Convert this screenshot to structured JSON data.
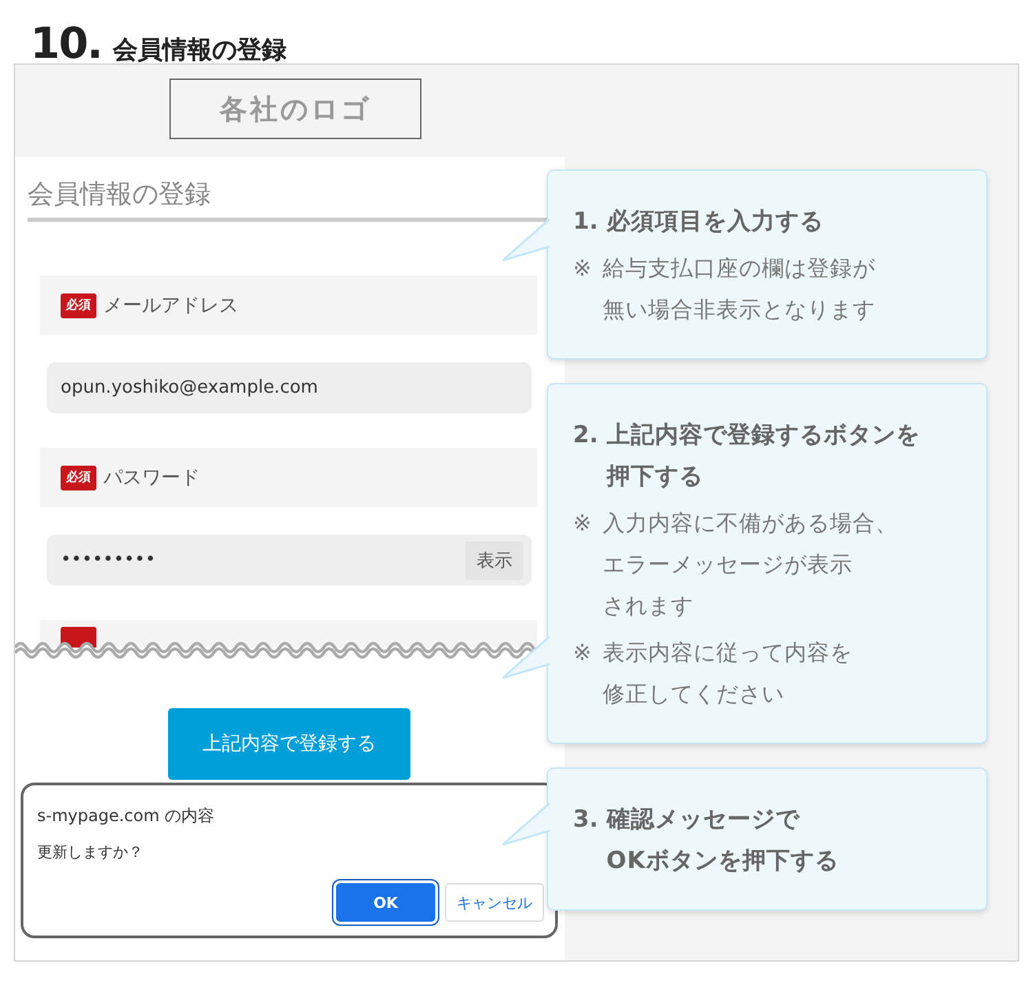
{
  "heading": {
    "number": "10.",
    "title": "会員情報の登録"
  },
  "screen": {
    "logo": "各社のロゴ",
    "form_title": "会員情報の登録",
    "fields": [
      {
        "kind": "text",
        "badge": "必須",
        "label": "メールアドレス",
        "value": "opun.yoshiko@example.com"
      },
      {
        "kind": "password",
        "badge": "必須",
        "label": "パスワード",
        "value": "•••••••••",
        "reveal": "表示"
      }
    ],
    "submit": "上記内容で登録する",
    "dialog": {
      "title": "s-mypage.com の内容",
      "message": "更新しますか？",
      "buttons": [
        {
          "label": "OK",
          "selected": true
        },
        {
          "label": "キャンセル",
          "selected": false
        }
      ]
    }
  },
  "callouts": [
    {
      "number": "1.",
      "title_lines": [
        "必須項目を入力する"
      ],
      "notes": [
        {
          "mark": "※",
          "lines": [
            "給与支払口座の欄は登録が",
            "無い場合非表示となります"
          ]
        }
      ]
    },
    {
      "number": "2.",
      "title_lines": [
        "上記内容で登録するボタンを",
        "押下する"
      ],
      "notes": [
        {
          "mark": "※",
          "lines": [
            "入力内容に不備がある場合、",
            "エラーメッセージが表示",
            "されます"
          ]
        },
        {
          "mark": "※",
          "lines": [
            "表示内容に従って内容を",
            "修正してください"
          ]
        }
      ]
    },
    {
      "number": "3.",
      "title_lines": [
        "確認メッセージで",
        "OKボタンを押下する"
      ]
    }
  ]
}
